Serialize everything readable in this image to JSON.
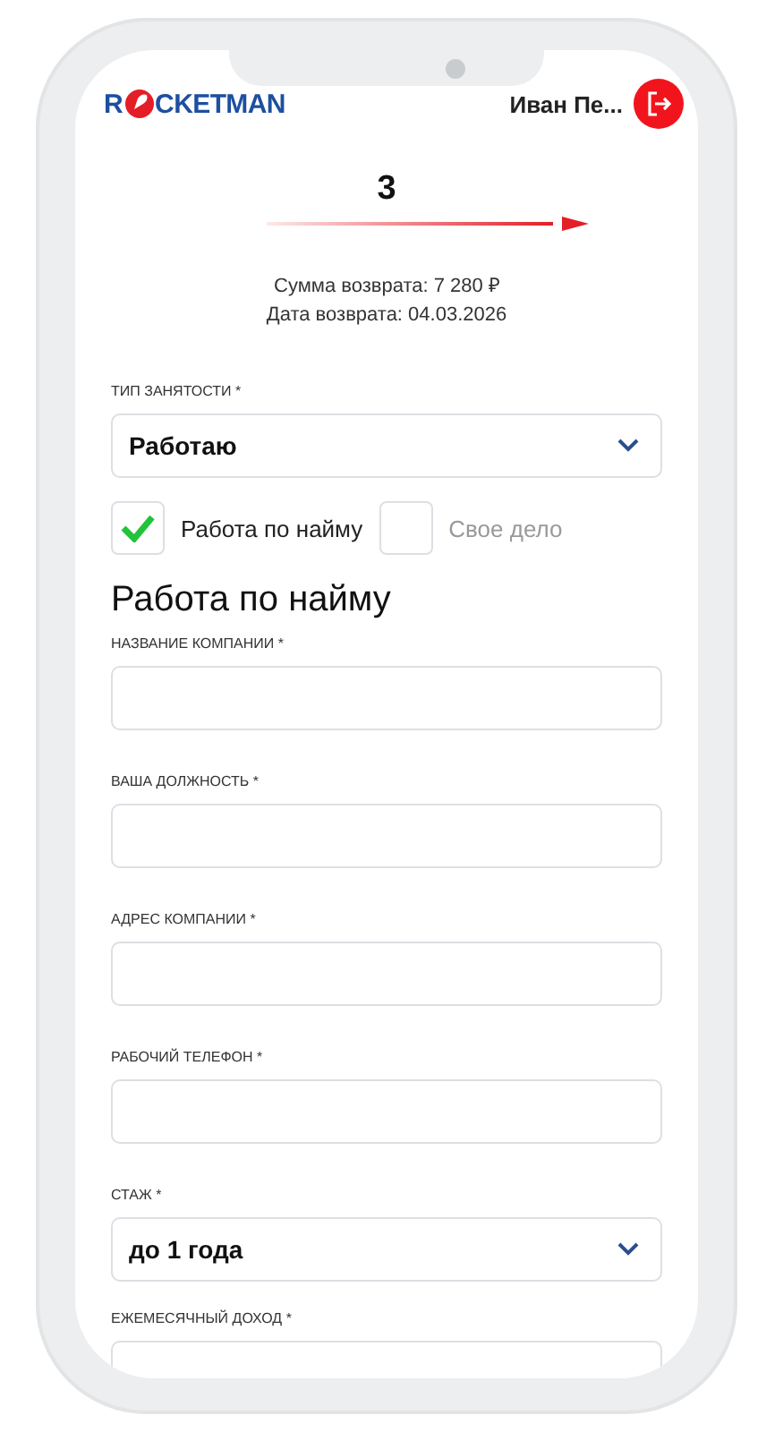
{
  "header": {
    "logo_before": "R",
    "logo_after": "CKETMAN",
    "user_name": "Иван Пе..."
  },
  "step": {
    "number": "3"
  },
  "summary": [
    "Сумма возврата: 7 280 ₽",
    "Дата возврата: 04.03.2026"
  ],
  "employment": {
    "label": "ТИП ЗАНЯТОСТИ *",
    "value": "Работаю"
  },
  "options": [
    {
      "label": "Работа по найму",
      "checked": true
    },
    {
      "label": "Свое дело",
      "checked": false
    }
  ],
  "section_title": "Работа по найму",
  "fields": [
    {
      "kind": "input",
      "label": "НАЗВАНИЕ КОМПАНИИ *"
    },
    {
      "kind": "input",
      "label": "ВАША ДОЛЖНОСТЬ *"
    },
    {
      "kind": "input",
      "label": "АДРЕС КОМПАНИИ *"
    },
    {
      "kind": "input",
      "label": "РАБОЧИЙ ТЕЛЕФОН *"
    },
    {
      "kind": "select",
      "label": "СТАЖ *",
      "value": "до 1 года"
    },
    {
      "kind": "input",
      "label": "ЕЖЕМЕСЯЧНЫЙ ДОХОД *"
    }
  ]
}
